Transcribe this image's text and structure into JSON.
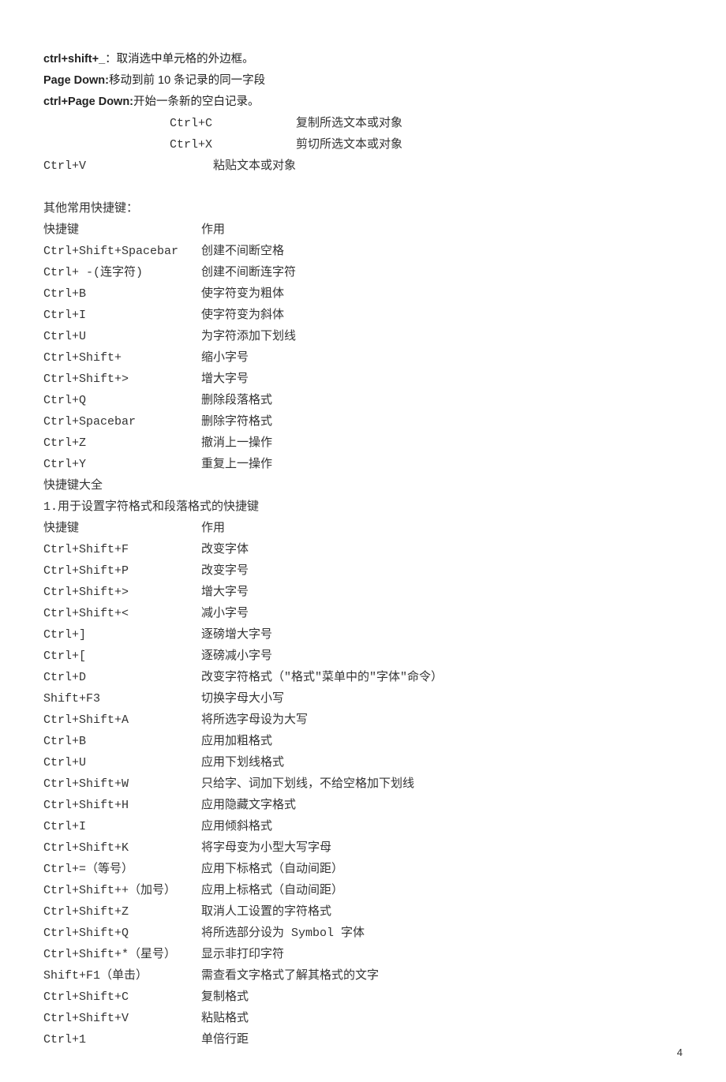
{
  "intro": [
    {
      "key": "ctrl+shift+_",
      "sep": "：",
      "desc": "取消选中单元格的外边框。"
    },
    {
      "key": "Page Down:",
      "sep": "",
      "desc": "移动到前 10 条记录的同一字段"
    },
    {
      "key": "ctrl+Page Down:",
      "sep": "",
      "desc": "开始一条新的空白记录。"
    }
  ],
  "clipboard": [
    {
      "key": "Ctrl+C",
      "desc": "复制所选文本或对象"
    },
    {
      "key": "Ctrl+X",
      "desc": "剪切所选文本或对象"
    }
  ],
  "paste": {
    "key": "Ctrl+V",
    "desc": "粘贴文本或对象"
  },
  "section1_title": "其他常用快捷键：",
  "header1": {
    "key": "快捷键",
    "desc": "作用"
  },
  "list1": [
    {
      "key": "Ctrl+Shift+Spacebar",
      "desc": "创建不间断空格"
    },
    {
      "key": "Ctrl+ -(连字符)",
      "desc": "创建不间断连字符"
    },
    {
      "key": "Ctrl+B",
      "desc": "使字符变为粗体"
    },
    {
      "key": "Ctrl+I",
      "desc": "使字符变为斜体"
    },
    {
      "key": "Ctrl+U",
      "desc": "为字符添加下划线"
    },
    {
      "key": "Ctrl+Shift+",
      "desc": "缩小字号"
    },
    {
      "key": "Ctrl+Shift+>",
      "desc": "增大字号"
    },
    {
      "key": "Ctrl+Q",
      "desc": "删除段落格式"
    },
    {
      "key": "Ctrl+Spacebar",
      "desc": "删除字符格式"
    },
    {
      "key": "Ctrl+Z",
      "desc": "撤消上一操作"
    },
    {
      "key": "Ctrl+Y",
      "desc": "重复上一操作"
    }
  ],
  "section2_title": "快捷键大全",
  "section2_sub": "1.用于设置字符格式和段落格式的快捷键",
  "header2": {
    "key": "快捷键",
    "desc": "作用"
  },
  "list2": [
    {
      "key": "Ctrl+Shift+F",
      "desc": "改变字体"
    },
    {
      "key": "Ctrl+Shift+P",
      "desc": "改变字号"
    },
    {
      "key": "Ctrl+Shift+>",
      "desc": "增大字号"
    },
    {
      "key": "Ctrl+Shift+<",
      "desc": "减小字号"
    },
    {
      "key": "Ctrl+]",
      "desc": "逐磅增大字号"
    },
    {
      "key": "Ctrl+[",
      "desc": "逐磅减小字号"
    },
    {
      "key": "Ctrl+D",
      "desc": "改变字符格式（\"格式\"菜单中的\"字体\"命令）"
    },
    {
      "key": "Shift+F3",
      "desc": "切换字母大小写"
    },
    {
      "key": "Ctrl+Shift+A",
      "desc": "将所选字母设为大写"
    },
    {
      "key": "Ctrl+B",
      "desc": "应用加粗格式"
    },
    {
      "key": "Ctrl+U",
      "desc": "应用下划线格式"
    },
    {
      "key": "Ctrl+Shift+W",
      "desc": "只给字、词加下划线，不给空格加下划线"
    },
    {
      "key": "Ctrl+Shift+H",
      "desc": "应用隐藏文字格式"
    },
    {
      "key": "Ctrl+I",
      "desc": "应用倾斜格式"
    },
    {
      "key": "Ctrl+Shift+K",
      "desc": "将字母变为小型大写字母"
    },
    {
      "key": "Ctrl+=（等号）",
      "desc": "应用下标格式（自动间距）"
    },
    {
      "key": "Ctrl+Shift++（加号）",
      "desc": "应用上标格式（自动间距）"
    },
    {
      "key": "Ctrl+Shift+Z",
      "desc": "取消人工设置的字符格式"
    },
    {
      "key": "Ctrl+Shift+Q",
      "desc": "将所选部分设为 Symbol 字体"
    },
    {
      "key": "Ctrl+Shift+*（星号）",
      "desc": "显示非打印字符"
    },
    {
      "key": "Shift+F1（单击）",
      "desc": "需查看文字格式了解其格式的文字"
    },
    {
      "key": "Ctrl+Shift+C",
      "desc": "复制格式"
    },
    {
      "key": "Ctrl+Shift+V",
      "desc": "粘贴格式"
    },
    {
      "key": "Ctrl+1",
      "desc": "单倍行距"
    }
  ],
  "page_number": "4"
}
